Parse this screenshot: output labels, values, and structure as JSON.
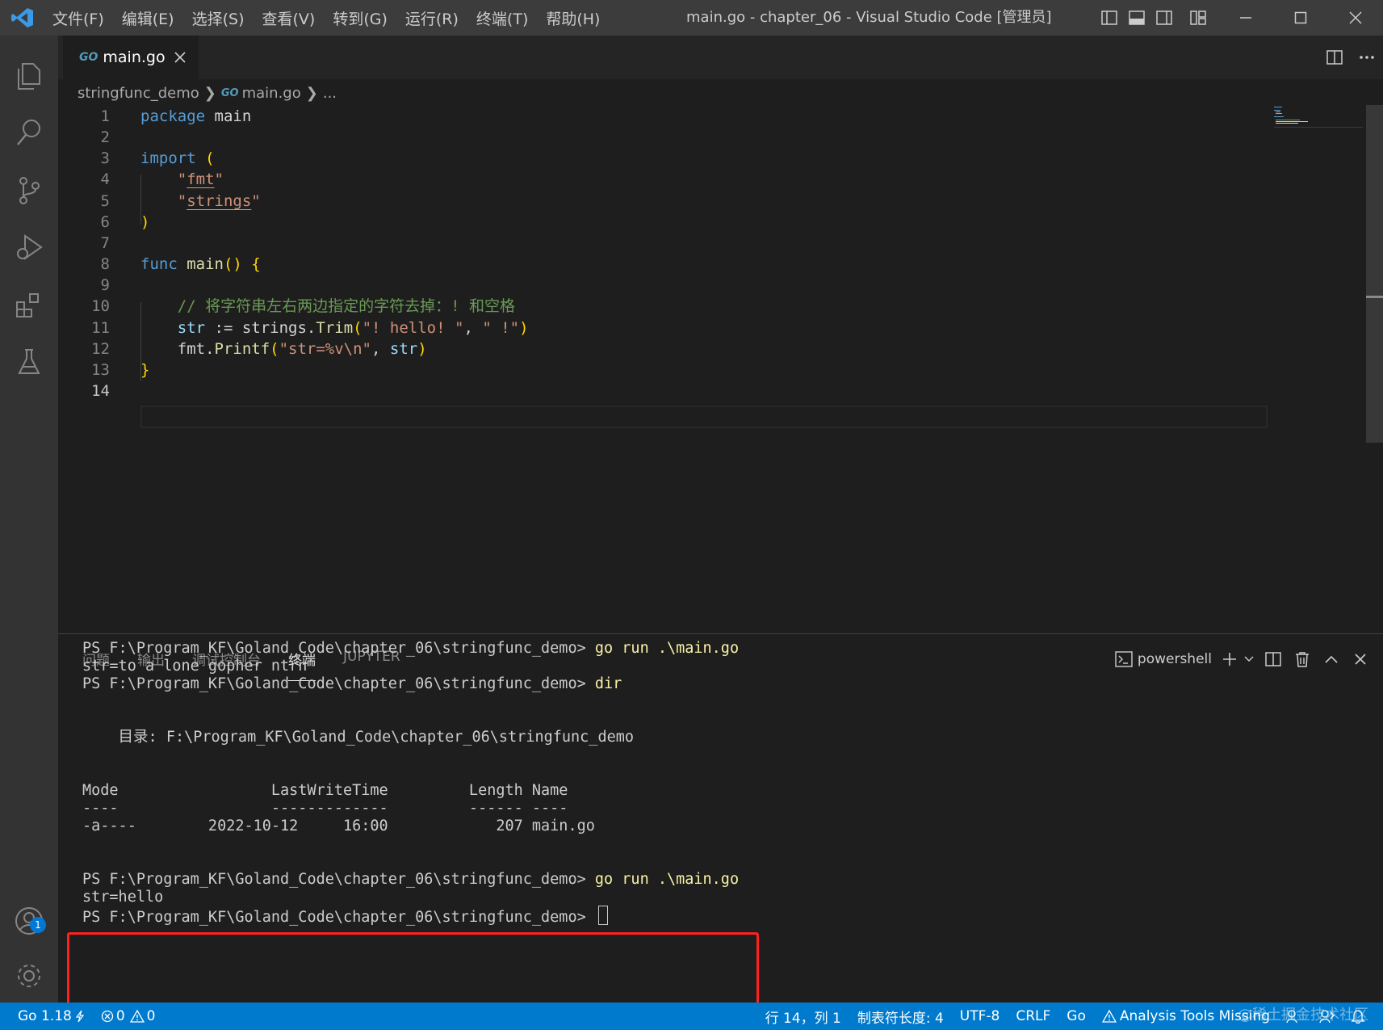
{
  "window": {
    "title": "main.go - chapter_06 - Visual Studio Code [管理员]",
    "menu": [
      "文件(F)",
      "编辑(E)",
      "选择(S)",
      "查看(V)",
      "转到(G)",
      "运行(R)",
      "终端(T)",
      "帮助(H)"
    ]
  },
  "activity_bar": {
    "items": [
      "explorer-icon",
      "search-icon",
      "source-control-icon",
      "run-debug-icon",
      "extensions-icon",
      "testing-icon"
    ],
    "accounts_badge": "1"
  },
  "editor": {
    "tab": {
      "icon_text": "GO",
      "label": "main.go"
    },
    "breadcrumb": {
      "folder": "stringfunc_demo",
      "icon_text": "GO",
      "file": "main.go",
      "more": "..."
    },
    "lines": [
      {
        "n": "1",
        "parts": [
          [
            "kw",
            "package"
          ],
          [
            "pkg",
            " main"
          ]
        ]
      },
      {
        "n": "2",
        "parts": []
      },
      {
        "n": "3",
        "parts": [
          [
            "kw",
            "import"
          ],
          [
            "pkg",
            " "
          ],
          [
            "br",
            "("
          ]
        ]
      },
      {
        "n": "4",
        "parts": [
          [
            "pkg",
            "    "
          ],
          [
            "str",
            "\""
          ],
          [
            "str ul",
            "fmt"
          ],
          [
            "str",
            "\""
          ]
        ]
      },
      {
        "n": "5",
        "parts": [
          [
            "pkg",
            "    "
          ],
          [
            "str",
            "\""
          ],
          [
            "str ul",
            "strings"
          ],
          [
            "str",
            "\""
          ]
        ]
      },
      {
        "n": "6",
        "parts": [
          [
            "br",
            ")"
          ]
        ]
      },
      {
        "n": "7",
        "parts": []
      },
      {
        "n": "8",
        "parts": [
          [
            "kw",
            "func"
          ],
          [
            "pkg",
            " "
          ],
          [
            "fn",
            "main"
          ],
          [
            "br",
            "()"
          ],
          [
            "pkg",
            " "
          ],
          [
            "br",
            "{"
          ]
        ]
      },
      {
        "n": "9",
        "parts": []
      },
      {
        "n": "10",
        "parts": [
          [
            "pkg",
            "    "
          ],
          [
            "cm",
            "// 将字符串左右两边指定的字符去掉：! 和空格"
          ]
        ]
      },
      {
        "n": "11",
        "parts": [
          [
            "pkg",
            "    "
          ],
          [
            "var",
            "str"
          ],
          [
            "pkg",
            " := strings."
          ],
          [
            "fn",
            "Trim"
          ],
          [
            "br",
            "("
          ],
          [
            "str",
            "\"! hello! \""
          ],
          [
            "pkg",
            ", "
          ],
          [
            "str",
            "\" !\""
          ],
          [
            "br",
            ")"
          ]
        ]
      },
      {
        "n": "12",
        "parts": [
          [
            "pkg",
            "    fmt."
          ],
          [
            "fn",
            "Printf"
          ],
          [
            "br",
            "("
          ],
          [
            "str",
            "\"str=%v\\n\""
          ],
          [
            "pkg",
            ", "
          ],
          [
            "var",
            "str"
          ],
          [
            "br",
            ")"
          ]
        ]
      },
      {
        "n": "13",
        "parts": [
          [
            "br",
            "}"
          ]
        ]
      },
      {
        "n": "14",
        "parts": []
      }
    ],
    "active_line": "14"
  },
  "panel": {
    "tabs": [
      "问题",
      "输出",
      "调试控制台",
      "终端",
      "JUPYTER"
    ],
    "active_tab": "终端",
    "shell": "powershell",
    "terminal": [
      {
        "prompt": "PS F:\\Program_KF\\Goland_Code\\chapter_06\\stringfunc_demo> ",
        "cmd": "go run .\\main.go"
      },
      {
        "text": "str=to a lone gopher ntrn"
      },
      {
        "prompt": "PS F:\\Program_KF\\Goland_Code\\chapter_06\\stringfunc_demo> ",
        "cmd": "dir"
      },
      {
        "text": "    目录: F:\\Program_KF\\Goland_Code\\chapter_06\\stringfunc_demo"
      },
      {
        "text": "Mode                 LastWriteTime         Length Name"
      },
      {
        "text": "----                 -------------         ------ ----"
      },
      {
        "text": "-a----        2022-10-12     16:00            207 main.go"
      },
      {
        "prompt": "PS F:\\Program_KF\\Goland_Code\\chapter_06\\stringfunc_demo> ",
        "cmd": "go run .\\main.go"
      },
      {
        "text": "str=hello"
      },
      {
        "prompt": "PS F:\\Program_KF\\Goland_Code\\chapter_06\\stringfunc_demo> ",
        "cmd": ""
      }
    ]
  },
  "status_bar": {
    "go_version": "Go 1.18",
    "errors": "0",
    "warnings": "0",
    "position": "行 14，列 1",
    "indent": "制表符长度: 4",
    "encoding": "UTF-8",
    "eol": "CRLF",
    "language": "Go",
    "analysis": "Analysis Tools Missing"
  },
  "watermark": "@稀土掘金技术社区",
  "colors": {
    "accent": "#007acc",
    "highlight_box": "#ff2020"
  }
}
